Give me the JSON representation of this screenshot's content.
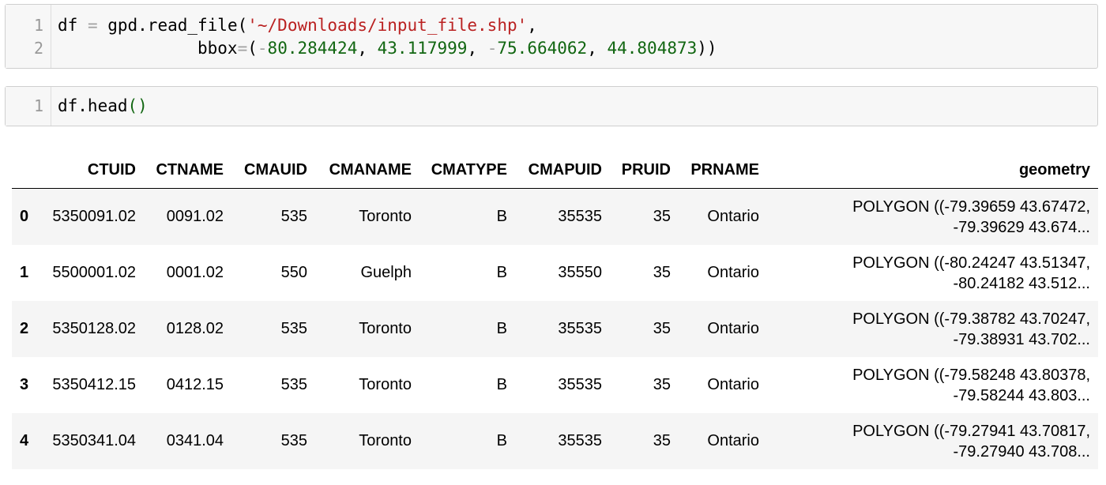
{
  "cells": [
    {
      "lines": [
        {
          "num": "1",
          "tokens": [
            {
              "t": "df ",
              "c": ""
            },
            {
              "t": "=",
              "c": "op"
            },
            {
              "t": " gpd.read_file(",
              "c": ""
            },
            {
              "t": "'~/Downloads/input_file.shp'",
              "c": "str"
            },
            {
              "t": ",",
              "c": ""
            }
          ]
        },
        {
          "num": "2",
          "tokens": [
            {
              "t": "              bbox",
              "c": ""
            },
            {
              "t": "=",
              "c": "op"
            },
            {
              "t": "(",
              "c": ""
            },
            {
              "t": "-",
              "c": "op"
            },
            {
              "t": "80.284424",
              "c": "num"
            },
            {
              "t": ", ",
              "c": ""
            },
            {
              "t": "43.117999",
              "c": "num"
            },
            {
              "t": ", ",
              "c": ""
            },
            {
              "t": "-",
              "c": "op"
            },
            {
              "t": "75.664062",
              "c": "num"
            },
            {
              "t": ", ",
              "c": ""
            },
            {
              "t": "44.804873",
              "c": "num"
            },
            {
              "t": "))",
              "c": ""
            }
          ]
        }
      ]
    },
    {
      "lines": [
        {
          "num": "1",
          "tokens": [
            {
              "t": "df.head",
              "c": ""
            },
            {
              "t": "()",
              "c": "paren"
            }
          ]
        }
      ]
    }
  ],
  "table": {
    "columns": [
      "",
      "CTUID",
      "CTNAME",
      "CMAUID",
      "CMANAME",
      "CMATYPE",
      "CMAPUID",
      "PRUID",
      "PRNAME",
      "geometry"
    ],
    "rows": [
      {
        "index": "0",
        "CTUID": "5350091.02",
        "CTNAME": "0091.02",
        "CMAUID": "535",
        "CMANAME": "Toronto",
        "CMATYPE": "B",
        "CMAPUID": "35535",
        "PRUID": "35",
        "PRNAME": "Ontario",
        "geom1": "POLYGON ((-79.39659 43.67472,",
        "geom2": "-79.39629 43.674..."
      },
      {
        "index": "1",
        "CTUID": "5500001.02",
        "CTNAME": "0001.02",
        "CMAUID": "550",
        "CMANAME": "Guelph",
        "CMATYPE": "B",
        "CMAPUID": "35550",
        "PRUID": "35",
        "PRNAME": "Ontario",
        "geom1": "POLYGON ((-80.24247 43.51347,",
        "geom2": "-80.24182 43.512..."
      },
      {
        "index": "2",
        "CTUID": "5350128.02",
        "CTNAME": "0128.02",
        "CMAUID": "535",
        "CMANAME": "Toronto",
        "CMATYPE": "B",
        "CMAPUID": "35535",
        "PRUID": "35",
        "PRNAME": "Ontario",
        "geom1": "POLYGON ((-79.38782 43.70247,",
        "geom2": "-79.38931 43.702..."
      },
      {
        "index": "3",
        "CTUID": "5350412.15",
        "CTNAME": "0412.15",
        "CMAUID": "535",
        "CMANAME": "Toronto",
        "CMATYPE": "B",
        "CMAPUID": "35535",
        "PRUID": "35",
        "PRNAME": "Ontario",
        "geom1": "POLYGON ((-79.58248 43.80378,",
        "geom2": "-79.58244 43.803..."
      },
      {
        "index": "4",
        "CTUID": "5350341.04",
        "CTNAME": "0341.04",
        "CMAUID": "535",
        "CMANAME": "Toronto",
        "CMATYPE": "B",
        "CMAPUID": "35535",
        "PRUID": "35",
        "PRNAME": "Ontario",
        "geom1": "POLYGON ((-79.27941 43.70817,",
        "geom2": "-79.27940 43.708..."
      }
    ]
  }
}
